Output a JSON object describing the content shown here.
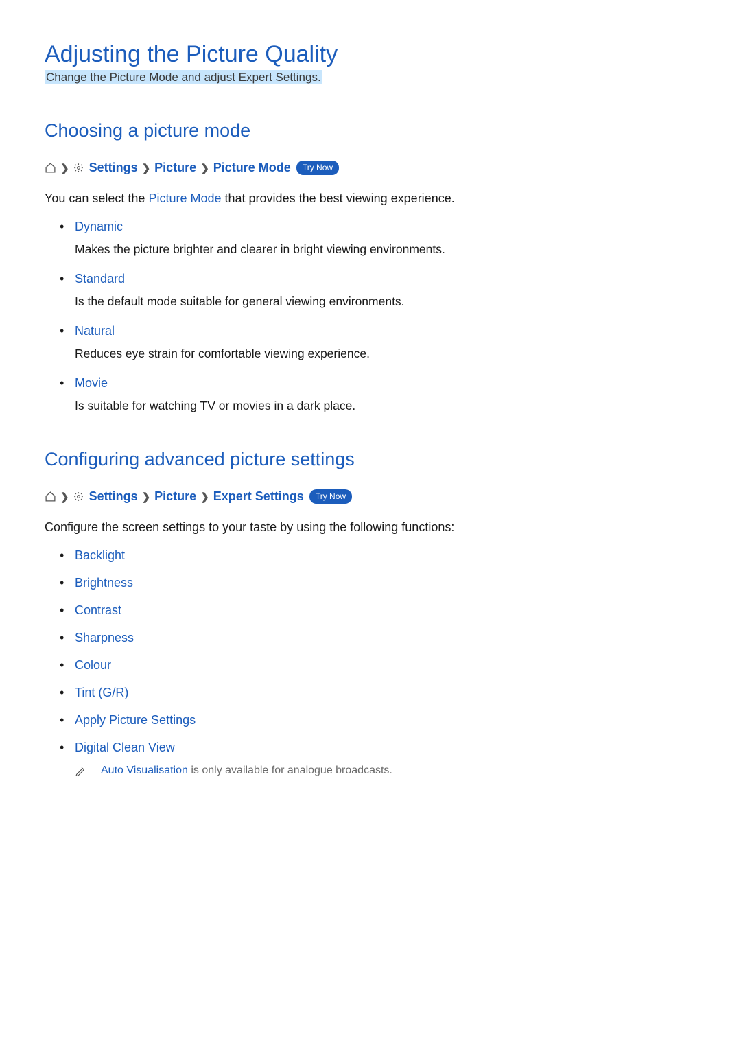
{
  "page": {
    "title": "Adjusting the Picture Quality",
    "subtitle": "Change the Picture Mode and adjust Expert Settings."
  },
  "section1": {
    "title": "Choosing a picture mode",
    "breadcrumb": {
      "settings": "Settings",
      "picture": "Picture",
      "pictureMode": "Picture Mode",
      "tryNow": "Try Now"
    },
    "intro_prefix": "You can select the ",
    "intro_link": "Picture Mode",
    "intro_suffix": " that provides the best viewing experience.",
    "modes": [
      {
        "name": "Dynamic",
        "desc": "Makes the picture brighter and clearer in bright viewing environments."
      },
      {
        "name": "Standard",
        "desc": "Is the default mode suitable for general viewing environments."
      },
      {
        "name": "Natural",
        "desc": "Reduces eye strain for comfortable viewing experience."
      },
      {
        "name": "Movie",
        "desc": "Is suitable for watching TV or movies in a dark place."
      }
    ]
  },
  "section2": {
    "title": "Configuring advanced picture settings",
    "breadcrumb": {
      "settings": "Settings",
      "picture": "Picture",
      "expertSettings": "Expert Settings",
      "tryNow": "Try Now"
    },
    "intro": "Configure the screen settings to your taste by using the following functions:",
    "settings": [
      "Backlight",
      "Brightness",
      "Contrast",
      "Sharpness",
      "Colour",
      "Tint (G/R)",
      "Apply Picture Settings",
      "Digital Clean View"
    ],
    "note_highlight": "Auto Visualisation",
    "note_suffix": " is only available for analogue broadcasts."
  }
}
